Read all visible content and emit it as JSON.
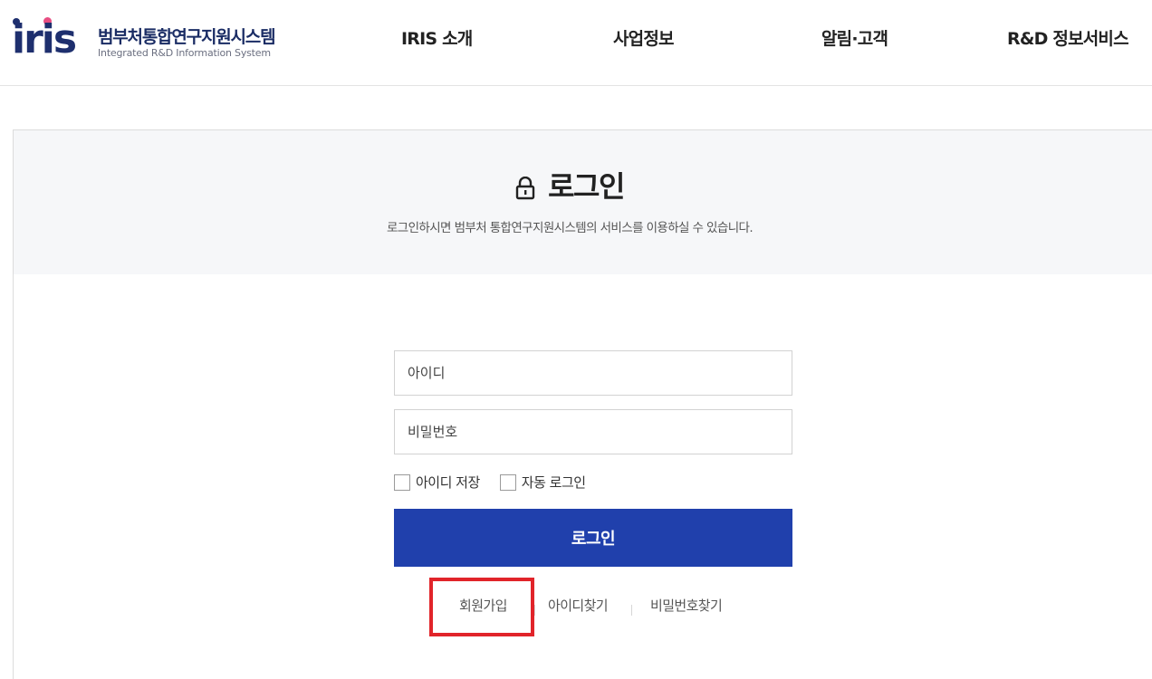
{
  "header": {
    "logo_text": "iris",
    "logo_kr": "범부처통합연구지원시스템",
    "logo_en": "Integrated R&D Information System",
    "nav": [
      "IRIS 소개",
      "사업정보",
      "알림·고객",
      "R&D 정보서비스"
    ]
  },
  "login": {
    "title": "로그인",
    "subtitle": "로그인하시면 범부처 통합연구지원시스템의 서비스를 이용하실 수 있습니다.",
    "id_placeholder": "아이디",
    "pw_placeholder": "비밀번호",
    "save_id_label": "아이디 저장",
    "auto_login_label": "자동 로그인",
    "button_label": "로그인",
    "links": {
      "signup": "회원가입",
      "find_id": "아이디찾기",
      "find_pw": "비밀번호찾기"
    }
  },
  "colors": {
    "brand_navy": "#1e2f6e",
    "brand_pink": "#e84d82",
    "button_blue": "#2040ac",
    "highlight_red": "#e1242a"
  },
  "icons": {
    "title_icon": "lock-icon"
  }
}
